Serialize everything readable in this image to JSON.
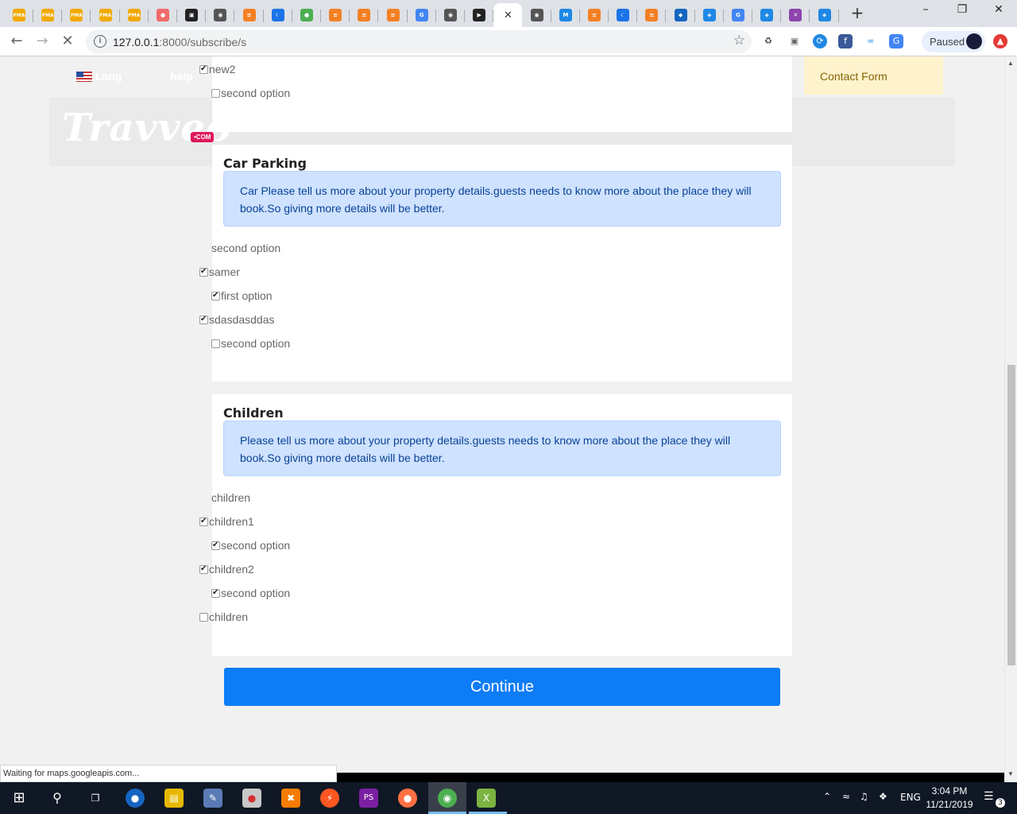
{
  "browser": {
    "url_host": "127.0.0.1",
    "url_rest": ":8000/subscribe/s",
    "profile_label": "Paused",
    "status_text": "Waiting for maps.googleapis.com..."
  },
  "tabs": [
    {
      "icon": "pma-icon",
      "text": "PMA",
      "color": "#f2a900"
    },
    {
      "icon": "pma-icon",
      "text": "PMA",
      "color": "#f2a900"
    },
    {
      "icon": "pma-icon",
      "text": "PMA",
      "color": "#f2a900"
    },
    {
      "icon": "pma-icon",
      "text": "PMA",
      "color": "#f2a900"
    },
    {
      "icon": "pma-icon",
      "text": "PMA",
      "color": "#f2a900"
    },
    {
      "icon": "asana-icon",
      "text": "●",
      "color": "#f06a6a"
    },
    {
      "icon": "edx-icon",
      "text": "▣",
      "color": "#222222"
    },
    {
      "icon": "globe-icon",
      "text": "◉",
      "color": "#555555"
    },
    {
      "icon": "stackoverflow-icon",
      "text": "≡",
      "color": "#f48024"
    },
    {
      "icon": "moon-icon",
      "text": "☾",
      "color": "#1a73e8"
    },
    {
      "icon": "leaf-icon",
      "text": "●",
      "color": "#4caf50"
    },
    {
      "icon": "stackoverflow-icon",
      "text": "≡",
      "color": "#f48024"
    },
    {
      "icon": "stackoverflow-icon",
      "text": "≡",
      "color": "#f48024"
    },
    {
      "icon": "stackoverflow-icon",
      "text": "≡",
      "color": "#f48024"
    },
    {
      "icon": "google-icon",
      "text": "G",
      "color": "#4285f4"
    },
    {
      "icon": "globe-icon",
      "text": "◉",
      "color": "#555555"
    },
    {
      "icon": "video-icon",
      "text": "▶",
      "color": "#222222"
    },
    {
      "icon": "active-tab-icon",
      "text": "",
      "color": "#ffffff"
    },
    {
      "icon": "globe-icon",
      "text": "◉",
      "color": "#555555"
    },
    {
      "icon": "m-icon",
      "text": "M",
      "color": "#1e88e5"
    },
    {
      "icon": "stackoverflow-icon",
      "text": "≡",
      "color": "#f48024"
    },
    {
      "icon": "moon-icon",
      "text": "☾",
      "color": "#1a73e8"
    },
    {
      "icon": "stackoverflow-icon",
      "text": "≡",
      "color": "#f48024"
    },
    {
      "icon": "pocket-icon",
      "text": "◆",
      "color": "#1565c0"
    },
    {
      "icon": "shield-icon",
      "text": "◈",
      "color": "#1e88e5"
    },
    {
      "icon": "google-icon",
      "text": "G",
      "color": "#4285f4"
    },
    {
      "icon": "shield-icon",
      "text": "◈",
      "color": "#1e88e5"
    },
    {
      "icon": "hex-icon",
      "text": "✕",
      "color": "#8e44ad"
    },
    {
      "icon": "shield-icon",
      "text": "◈",
      "color": "#1e88e5"
    }
  ],
  "header": {
    "lang_label": "Lang",
    "help_label": "help",
    "logo_text": "Travveo",
    "logo_badge": "•COM",
    "contact_label": "Contact Form"
  },
  "card1": {
    "items": [
      {
        "label": "new2",
        "checked": true
      },
      {
        "label": "second option",
        "checked": false
      }
    ]
  },
  "card2": {
    "title": "Car Parking",
    "alert": "Car Please tell us more about your property details.guests needs to know more about the place they will book.So giving more details will be better.",
    "group_label": "second option",
    "items": [
      {
        "label": "samer",
        "checked": true
      },
      {
        "label": "first option",
        "checked": true
      },
      {
        "label": "sdasdasddas",
        "checked": true
      },
      {
        "label": "second option",
        "checked": false
      }
    ]
  },
  "card3": {
    "title": "Children",
    "alert": "Please tell us more about your property details.guests needs to know more about the place they will book.So giving more details will be better.",
    "group_label": "children",
    "items": [
      {
        "label": "children1",
        "checked": true
      },
      {
        "label": "second option",
        "checked": true
      },
      {
        "label": "children2",
        "checked": true
      },
      {
        "label": "second option",
        "checked": true
      },
      {
        "label": "children",
        "checked": false
      }
    ]
  },
  "continue_label": "Continue",
  "taskbar": {
    "lang": "ENG",
    "time": "3:04 PM",
    "date": "11/21/2019",
    "notifications": "3"
  }
}
